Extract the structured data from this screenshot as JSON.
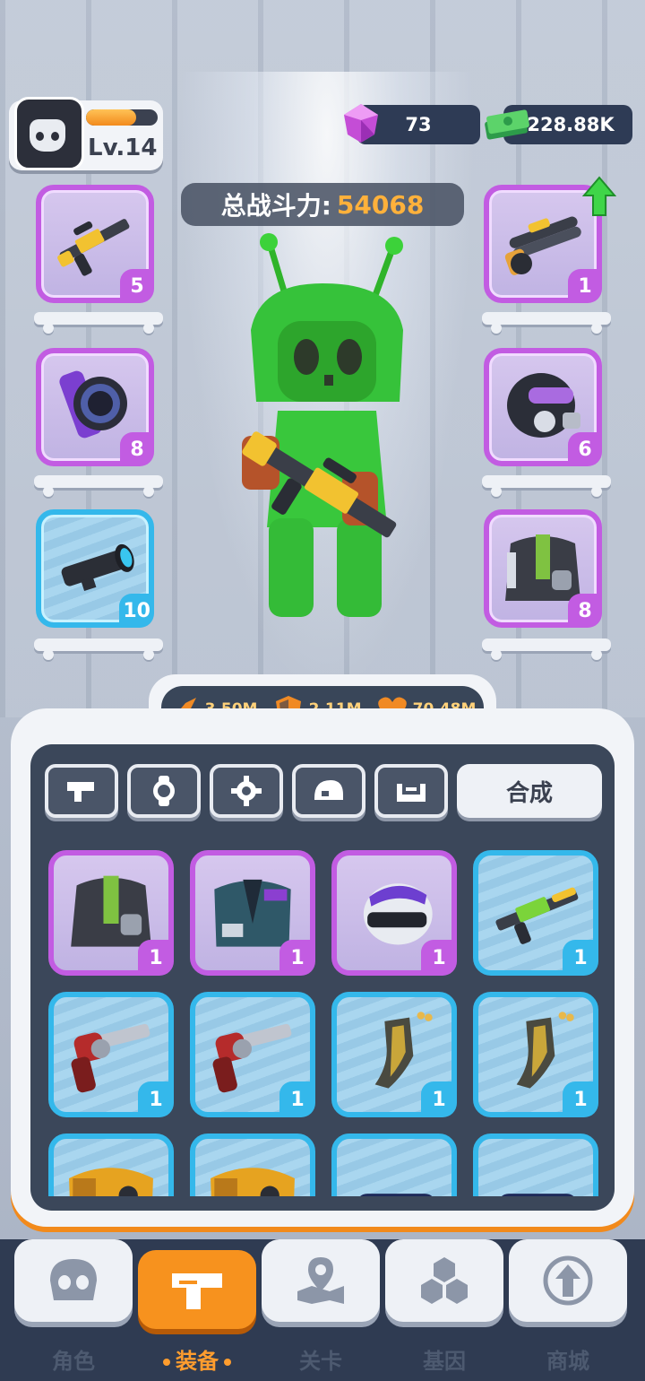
{
  "player": {
    "level_label": "Lv.14",
    "xp_fraction": 0.7
  },
  "currency": {
    "gems": "73",
    "cash": "228.88K"
  },
  "power": {
    "label": "总战斗力:",
    "value": "54068"
  },
  "equipped": {
    "left": [
      {
        "item": "rifle",
        "rarity": "purple",
        "count": "5"
      },
      {
        "item": "watch",
        "rarity": "purple",
        "count": "8"
      },
      {
        "item": "scope",
        "rarity": "blue",
        "count": "10"
      }
    ],
    "right": [
      {
        "item": "shotgun",
        "rarity": "purple",
        "count": "1",
        "upgrade_available": true
      },
      {
        "item": "gas-mask-helmet",
        "rarity": "purple",
        "count": "6"
      },
      {
        "item": "backpack-armor",
        "rarity": "purple",
        "count": "8"
      }
    ]
  },
  "stats": {
    "attack": "3.50M",
    "defense": "2.11M",
    "health": "70.48M"
  },
  "tabs": [
    "weapon",
    "accessory",
    "gear",
    "helmet",
    "armor"
  ],
  "merge_label": "合成",
  "inventory": [
    {
      "item": "backpack-armor",
      "rarity": "purple",
      "count": "1"
    },
    {
      "item": "suit-armor",
      "rarity": "purple",
      "count": "1"
    },
    {
      "item": "helmet",
      "rarity": "purple",
      "count": "1"
    },
    {
      "item": "green-rifle",
      "rarity": "blue",
      "count": "1"
    },
    {
      "item": "revolver",
      "rarity": "blue",
      "count": "1"
    },
    {
      "item": "revolver",
      "rarity": "blue",
      "count": "1"
    },
    {
      "item": "magazine",
      "rarity": "blue",
      "count": "1"
    },
    {
      "item": "magazine",
      "rarity": "blue",
      "count": "1"
    },
    {
      "item": "yellow-vest",
      "rarity": "blue",
      "count": ""
    },
    {
      "item": "yellow-vest",
      "rarity": "blue",
      "count": ""
    },
    {
      "item": "goggles",
      "rarity": "blue",
      "count": ""
    },
    {
      "item": "goggles",
      "rarity": "blue",
      "count": ""
    }
  ],
  "nav": [
    {
      "label": "角色",
      "icon": "skull-icon",
      "active": false
    },
    {
      "label": "装备",
      "icon": "gun-icon",
      "active": true
    },
    {
      "label": "关卡",
      "icon": "map-pin-icon",
      "active": false
    },
    {
      "label": "基因",
      "icon": "hexagons-icon",
      "active": false
    },
    {
      "label": "商城",
      "icon": "shop-icon",
      "active": false
    }
  ],
  "colors": {
    "accent": "#f7921e",
    "purple_rarity": "#c25ce2",
    "blue_rarity": "#34b8eb",
    "power_value": "#ffb13b"
  }
}
